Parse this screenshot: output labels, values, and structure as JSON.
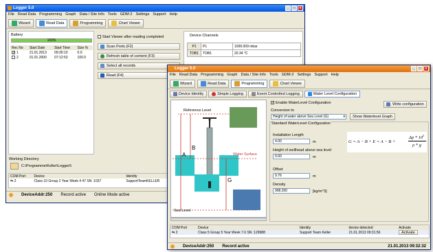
{
  "back": {
    "title": "Logger 5.0",
    "menu": [
      "File",
      "Read Data",
      "Programming",
      "Graph",
      "Data / Site Info",
      "Tools",
      "GDM-2",
      "Settings",
      "Support",
      "Help"
    ],
    "toolbar": {
      "wizard": "Wizard",
      "read_data": "Read Data",
      "programming": "Programming",
      "chart_viewer": "Chart Viewer"
    },
    "battery": {
      "label": "Battery",
      "percent": "100%",
      "level": 1.0
    },
    "records": {
      "headers": [
        "Rec No",
        "Start Date",
        "Start Time",
        "Size %"
      ],
      "rows": [
        [
          "1",
          "21.01.2013",
          "09:30:10",
          "0.0"
        ],
        [
          "2",
          "01.01.2000",
          "07:12:53",
          "100.0"
        ]
      ]
    },
    "start_viewer_label": "Start Viewer after reading completed",
    "buttons": {
      "scan": "Scan Ports (F2)",
      "refresh": "Refresh table of content (F3)",
      "select": "Select all records",
      "read": "Read (F4)"
    },
    "channels": {
      "label": "Device Channels",
      "rows": [
        [
          "P1",
          "P1",
          "1000.009 mbar"
        ],
        [
          "TOB1",
          "TOB1",
          "20.34 °C"
        ]
      ]
    },
    "working_dir": {
      "label": "Working Directory",
      "path": "C:\\Programme\\Keller\\Logger5"
    },
    "ports": {
      "headers": [
        "COM Port",
        "Device",
        "Identity"
      ],
      "row": [
        "2",
        "Class 10 Group 2 Year Week 4 47 SN :1037",
        "SupportTeamKELLER"
      ]
    },
    "status": {
      "addr": "DeviceAddr:250",
      "record": "Record active",
      "online": "Online Mode active"
    }
  },
  "front": {
    "title": "Logger 5.0",
    "menu": [
      "File",
      "Read Data",
      "Programming",
      "Graph",
      "Data / Site Info",
      "Tools",
      "GDM-2",
      "Settings",
      "Support",
      "Help"
    ],
    "toolbar": {
      "wizard": "Wizard",
      "read_data": "Read Data",
      "programming": "Programming",
      "chart_viewer": "Chart Viewer"
    },
    "tabs": [
      "Device Identity",
      "Simple Logging",
      "Event Controlled Logging",
      "Water Level Configuration"
    ],
    "diagram": {
      "reference": "Reference Level",
      "water_surface": "Water Surface",
      "sea_level": "Sea Level",
      "a": "A",
      "b": "B",
      "g": "G",
      "t": "T"
    },
    "enable_label": "Enable WaterLevel Configuration",
    "write_button": "Write configuration",
    "conversion": {
      "label": "Conversion to",
      "value": "Height of water above Sea Level (G)",
      "graph_button": "Show Waterlevel Graph"
    },
    "standard": {
      "label": "Standard WaterLevel Configuration",
      "install_label": "Installation Length",
      "install_value": "4.00",
      "install_unit": "m",
      "wellhead_label": "Height of wellhead above sea level",
      "wellhead_value": "0.00",
      "wellhead_unit": "m",
      "offset_label": "Offset",
      "offset_value": "9.76",
      "offset_unit": "m",
      "density_label": "Density",
      "density_value": "998.200",
      "density_unit": "[kg/m^3]"
    },
    "formula": {
      "lhs": "G = A − B + E = A − B +",
      "num": "Δp * 10",
      "exp": "5",
      "den": "ρ * g"
    },
    "ports": {
      "headers": [
        "COM Port",
        "Device",
        "Identity",
        "device detected",
        "Activate"
      ],
      "row": [
        "2",
        "Class 5 Group 5 Year Week 7.6 SN :129988",
        "Support Team Keller",
        "21.01.2013 09:31:56",
        "Activate"
      ]
    },
    "status": {
      "addr": "DeviceAddr:250",
      "record": "Record active",
      "datetime": "21.01.2013 09:32:32"
    }
  },
  "colors": {
    "title_blue": "#0054e3",
    "water": "#2fc6c8",
    "gauge_green": "#62c462",
    "orange": "#f0a020",
    "red_dash": "#e02020"
  }
}
